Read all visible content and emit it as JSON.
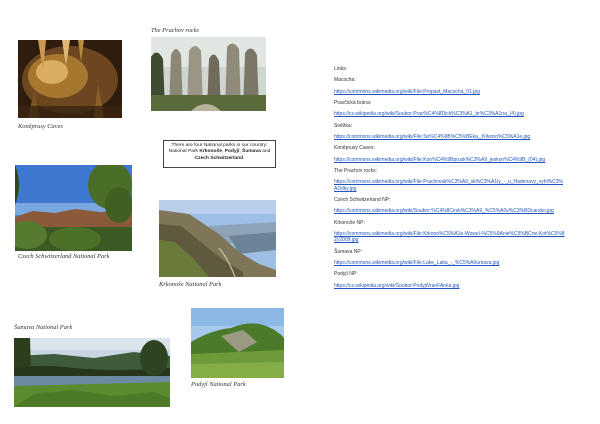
{
  "captions": {
    "koneprusy": "Koněprusy Caves",
    "prachov": "The Prachov rocks",
    "czech_switzerland": "Czech Schwitzerland National Park",
    "krkonose": "Krkonoše National Park",
    "sumava": "Šumava National Park",
    "podyji": "Podyjí National Park"
  },
  "note": {
    "line1": "There are four National parks in our country:",
    "prefix": "National Park ",
    "park1": "Krkonoše",
    "sep1": ", ",
    "park2": "Podyjí",
    "sep2": ", ",
    "park3": "Šumava",
    "and": " and",
    "park4": "Czech Schwitzerland",
    "end": "."
  },
  "links": {
    "heading": "Links:",
    "items": [
      {
        "label": "Macocha:",
        "url": "https://commons.wikimedia.org/wiki/File:Propast_Macocha_01.jpg"
      },
      {
        "label": "Pravčická brána:",
        "url": "https://cs.wikipedia.org/wiki/Soubor:Prav%C4%8Dick%C3%A1_br%C3%A1na_(4).jpg"
      },
      {
        "label": "Sněžka:",
        "url": "https://commons.wikimedia.org/wiki/File:Sn%C4%9B%C5%BEka,_Krkono%C5%A1e.jpg"
      },
      {
        "label": "Koněprusy Caves:",
        "url": "https://commons.wikimedia.org/wiki/File:Kon%C4%9Bprusk%C3%A9_jeskyn%C4%9B_(04).jpg"
      },
      {
        "label": "The Prachov rocks:",
        "url": "https://commons.wikimedia.org/wiki/File:Prachovsk%C3%A9_sk%C3%A1ly_-_u_Hadenovy_vyhl%C3%ADdky.jpg"
      },
      {
        "label": "Czech Schwitzerland NP:",
        "url": "https://commons.wikimedia.org/wiki/Soubor:%C4%8Cesk%C3%A9_%C5%A0v%C3%BDcarsko.jpg"
      },
      {
        "label": "Krkonoše NP:",
        "url": "https://commons.wikimedia.org/wiki/File:Krkono%C5%A1e-Wowel-%C5%9Anie%C5%BCne-Kot%C5%82y2009.jpg"
      },
      {
        "label": "Šumava NP:",
        "url": "https://commons.wikimedia.org/wiki/File:Lake_Laka_-_%C5%A0umava.jpg"
      },
      {
        "label": "Podyjí NP:",
        "url": "https://cs.wikipedia.org/wiki/Soubor:PodyjiVranFAnka.jpg"
      }
    ]
  }
}
